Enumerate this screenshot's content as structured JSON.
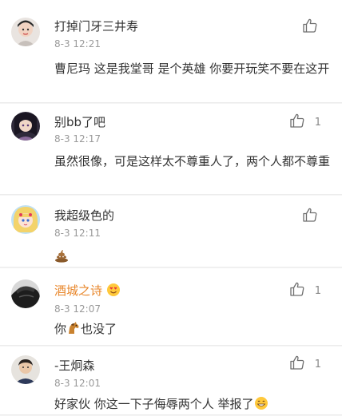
{
  "comments": [
    {
      "username": "打掉门牙三井寿",
      "time": "8-3 12:21",
      "content": "曹尼玛 这是我堂哥 是个英雄 你要开玩笑不要在这开",
      "like_count": ""
    },
    {
      "username": "别bb了吧",
      "time": "8-3 12:17",
      "content": "虽然很像，可是这样太不尊重人了，两个人都不尊重",
      "like_count": "1"
    },
    {
      "username": "我超级色的",
      "time": "8-3 12:11",
      "content": "",
      "content_emoji": "poop-emoji",
      "like_count": ""
    },
    {
      "username": "酒城之诗",
      "username_badge": "love-emoji",
      "time": "8-3 12:07",
      "content_before": "你",
      "content_emoji": "horse-emoji",
      "content_after": "也没了",
      "like_count": "1"
    },
    {
      "username": "-王炯森",
      "time": "8-3 12:01",
      "content": "好家伙 你这一下子侮辱两个人 举报了",
      "content_emoji": "grin-emoji",
      "like_count": "1"
    }
  ],
  "colors": {
    "text": "#333333",
    "meta": "#9a9a9a",
    "vip_name": "#e8862a",
    "divider": "#ececec"
  }
}
